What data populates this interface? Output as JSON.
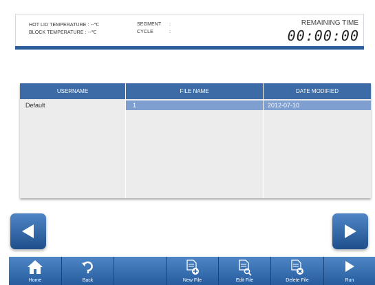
{
  "status": {
    "hot_lid_label": "HOT LID TEMPERATURE :",
    "hot_lid_value": "--℃",
    "block_label": "BLOCK TEMPERATURE  :",
    "block_value": "--℃",
    "segment_label": "SEGMENT",
    "segment_value": ":",
    "cycle_label": "CYCLE",
    "cycle_value": ":",
    "remaining_label": "REMAINING TIME",
    "remaining_value": "00:00:00"
  },
  "table": {
    "headers": [
      "USERNAME",
      "FILE NAME",
      "DATE MODIFIED"
    ],
    "rows": [
      {
        "username": "Default",
        "file_name": "1",
        "date_modified": "2012-07-10"
      }
    ]
  },
  "toolbar": {
    "home": "Home",
    "back": "Back",
    "new_file": "New File",
    "edit_file": "Edit File",
    "delete_file": "Delete File",
    "run": "Run"
  },
  "icons": {
    "prev": "left-arrow-icon",
    "next": "right-arrow-icon",
    "home": "home-icon",
    "back": "back-icon",
    "new_file": "new-file-icon",
    "edit_file": "edit-file-icon",
    "delete_file": "delete-file-icon",
    "run": "run-icon"
  },
  "colors": {
    "accent": "#3d6ba6",
    "selected_row": "#7f9fd0",
    "toolbar": "#275d9e"
  }
}
